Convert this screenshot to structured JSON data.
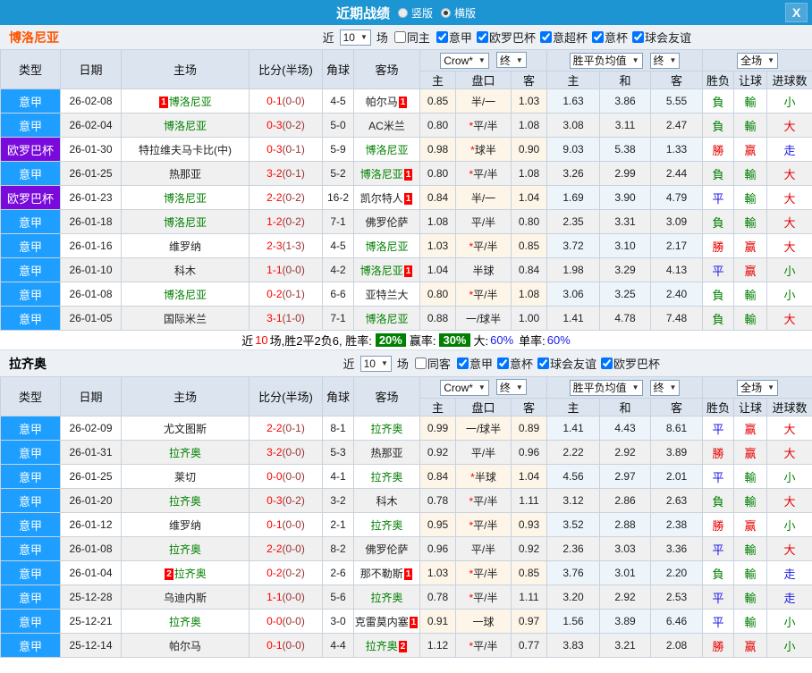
{
  "titlebar": {
    "title": "近期战绩",
    "vertical_label": "竖版",
    "horizontal_label": "横版",
    "layout_selected": "横版",
    "close_glyph": "X"
  },
  "controls": {
    "near_label": "近",
    "count_value": "10",
    "games_label": "场",
    "bookmaker": "Crow*",
    "final_label": "终",
    "wdl_label": "胜平负均值",
    "scope_label": "全场"
  },
  "columns": {
    "type": "类型",
    "date": "日期",
    "home": "主场",
    "score": "比分(半场)",
    "corner": "角球",
    "away": "客场",
    "odds_home": "主",
    "line": "盘口",
    "odds_away": "客",
    "avg_home": "主",
    "avg_draw": "和",
    "avg_away": "客",
    "result": "胜负",
    "handicap": "让球",
    "goals": "进球数"
  },
  "league_colors": {
    "意甲": "#1e9fff",
    "欧罗巴杯": "#7a0adc"
  },
  "result_colors": {
    "red": "#e60000",
    "green": "#008000",
    "blue": "#1a1ae6"
  },
  "accent_colors": {
    "titlebar": "#1d95d3",
    "team1": "#ff5400",
    "badge": "#ff0000",
    "pct_badge": "#008000"
  },
  "sections": [
    {
      "team": "博洛尼亚",
      "team_color": "#ff5400",
      "filter": {
        "same_label": "同主",
        "same_checked": false,
        "leagues": [
          "意甲",
          "欧罗巴杯",
          "意超杯",
          "意杯",
          "球会友谊"
        ]
      },
      "rows": [
        {
          "league": "意甲",
          "date": "26-02-08",
          "home": {
            "badge_before": "1",
            "name": "博洛尼亚",
            "is_team": true
          },
          "score": "0-1",
          "half": "(0-0)",
          "corners": "4-5",
          "away": {
            "name": "帕尔马",
            "badge_after": "1"
          },
          "odds": [
            "0.85",
            "半/一",
            "1.03"
          ],
          "avg": [
            "1.63",
            "3.86",
            "5.55"
          ],
          "result": [
            "負",
            "green"
          ],
          "handicap": [
            "輸",
            "green"
          ],
          "goals": [
            "小",
            "green"
          ]
        },
        {
          "league": "意甲",
          "date": "26-02-04",
          "home": {
            "name": "博洛尼亚",
            "is_team": true
          },
          "score": "0-3",
          "half": "(0-2)",
          "corners": "5-0",
          "away": {
            "name": "AC米兰"
          },
          "odds": [
            "0.80",
            "*平/半",
            "1.08"
          ],
          "avg": [
            "3.08",
            "3.11",
            "2.47"
          ],
          "result": [
            "負",
            "green"
          ],
          "handicap": [
            "輸",
            "green"
          ],
          "goals": [
            "大",
            "red"
          ]
        },
        {
          "league": "欧罗巴杯",
          "date": "26-01-30",
          "home": {
            "name": "特拉维夫马卡比(中)"
          },
          "score": "0-3",
          "half": "(0-1)",
          "corners": "5-9",
          "away": {
            "name": "博洛尼亚",
            "is_team": true
          },
          "odds": [
            "0.98",
            "*球半",
            "0.90"
          ],
          "avg": [
            "9.03",
            "5.38",
            "1.33"
          ],
          "result": [
            "勝",
            "red"
          ],
          "handicap": [
            "赢",
            "red"
          ],
          "goals": [
            "走",
            "blue"
          ]
        },
        {
          "league": "意甲",
          "date": "26-01-25",
          "home": {
            "name": "热那亚"
          },
          "score": "3-2",
          "half": "(0-1)",
          "corners": "5-2",
          "away": {
            "name": "博洛尼亚",
            "is_team": true,
            "badge_after": "1"
          },
          "odds": [
            "0.80",
            "*平/半",
            "1.08"
          ],
          "avg": [
            "3.26",
            "2.99",
            "2.44"
          ],
          "result": [
            "負",
            "green"
          ],
          "handicap": [
            "輸",
            "green"
          ],
          "goals": [
            "大",
            "red"
          ]
        },
        {
          "league": "欧罗巴杯",
          "date": "26-01-23",
          "home": {
            "name": "博洛尼亚",
            "is_team": true
          },
          "score": "2-2",
          "half": "(0-2)",
          "corners": "16-2",
          "away": {
            "name": "凯尔特人",
            "badge_after": "1"
          },
          "odds": [
            "0.84",
            "半/一",
            "1.04"
          ],
          "avg": [
            "1.69",
            "3.90",
            "4.79"
          ],
          "result": [
            "平",
            "blue"
          ],
          "handicap": [
            "輸",
            "green"
          ],
          "goals": [
            "大",
            "red"
          ]
        },
        {
          "league": "意甲",
          "date": "26-01-18",
          "home": {
            "name": "博洛尼亚",
            "is_team": true
          },
          "score": "1-2",
          "half": "(0-2)",
          "corners": "7-1",
          "away": {
            "name": "佛罗伦萨"
          },
          "odds": [
            "1.08",
            "平/半",
            "0.80"
          ],
          "avg": [
            "2.35",
            "3.31",
            "3.09"
          ],
          "result": [
            "負",
            "green"
          ],
          "handicap": [
            "輸",
            "green"
          ],
          "goals": [
            "大",
            "red"
          ]
        },
        {
          "league": "意甲",
          "date": "26-01-16",
          "home": {
            "name": "维罗纳"
          },
          "score": "2-3",
          "half": "(1-3)",
          "corners": "4-5",
          "away": {
            "name": "博洛尼亚",
            "is_team": true
          },
          "odds": [
            "1.03",
            "*平/半",
            "0.85"
          ],
          "avg": [
            "3.72",
            "3.10",
            "2.17"
          ],
          "result": [
            "勝",
            "red"
          ],
          "handicap": [
            "赢",
            "red"
          ],
          "goals": [
            "大",
            "red"
          ]
        },
        {
          "league": "意甲",
          "date": "26-01-10",
          "home": {
            "name": "科木"
          },
          "score": "1-1",
          "half": "(0-0)",
          "corners": "4-2",
          "away": {
            "name": "博洛尼亚",
            "is_team": true,
            "badge_after": "1"
          },
          "odds": [
            "1.04",
            "半球",
            "0.84"
          ],
          "avg": [
            "1.98",
            "3.29",
            "4.13"
          ],
          "result": [
            "平",
            "blue"
          ],
          "handicap": [
            "赢",
            "red"
          ],
          "goals": [
            "小",
            "green"
          ]
        },
        {
          "league": "意甲",
          "date": "26-01-08",
          "home": {
            "name": "博洛尼亚",
            "is_team": true
          },
          "score": "0-2",
          "half": "(0-1)",
          "corners": "6-6",
          "away": {
            "name": "亚特兰大"
          },
          "odds": [
            "0.80",
            "*平/半",
            "1.08"
          ],
          "avg": [
            "3.06",
            "3.25",
            "2.40"
          ],
          "result": [
            "負",
            "green"
          ],
          "handicap": [
            "輸",
            "green"
          ],
          "goals": [
            "小",
            "green"
          ]
        },
        {
          "league": "意甲",
          "date": "26-01-05",
          "home": {
            "name": "国际米兰"
          },
          "score": "3-1",
          "half": "(1-0)",
          "corners": "7-1",
          "away": {
            "name": "博洛尼亚",
            "is_team": true
          },
          "odds": [
            "0.88",
            "一/球半",
            "1.00"
          ],
          "avg": [
            "1.41",
            "4.78",
            "7.48"
          ],
          "result": [
            "負",
            "green"
          ],
          "handicap": [
            "輸",
            "green"
          ],
          "goals": [
            "大",
            "red"
          ]
        }
      ],
      "summary": {
        "near": "近",
        "count": "10",
        "detail": "场,胜2平2负6, 胜率:",
        "win_pct": "20%",
        "ying_label": "赢率:",
        "ying_pct": "30%",
        "big_label": "大:",
        "big_pct": "60%",
        "single_label": "单率:",
        "single_pct": "60%"
      }
    },
    {
      "team": "拉齐奥",
      "team_color": "#000000",
      "filter": {
        "same_label": "同客",
        "same_checked": false,
        "leagues": [
          "意甲",
          "意杯",
          "球会友谊",
          "欧罗巴杯"
        ]
      },
      "rows": [
        {
          "league": "意甲",
          "date": "26-02-09",
          "home": {
            "name": "尤文图斯"
          },
          "score": "2-2",
          "half": "(0-1)",
          "corners": "8-1",
          "away": {
            "name": "拉齐奥",
            "is_team": true
          },
          "odds": [
            "0.99",
            "一/球半",
            "0.89"
          ],
          "avg": [
            "1.41",
            "4.43",
            "8.61"
          ],
          "result": [
            "平",
            "blue"
          ],
          "handicap": [
            "赢",
            "red"
          ],
          "goals": [
            "大",
            "red"
          ]
        },
        {
          "league": "意甲",
          "date": "26-01-31",
          "home": {
            "name": "拉齐奥",
            "is_team": true
          },
          "score": "3-2",
          "half": "(0-0)",
          "corners": "5-3",
          "away": {
            "name": "热那亚"
          },
          "odds": [
            "0.92",
            "平/半",
            "0.96"
          ],
          "avg": [
            "2.22",
            "2.92",
            "3.89"
          ],
          "result": [
            "勝",
            "red"
          ],
          "handicap": [
            "赢",
            "red"
          ],
          "goals": [
            "大",
            "red"
          ]
        },
        {
          "league": "意甲",
          "date": "26-01-25",
          "home": {
            "name": "莱切"
          },
          "score": "0-0",
          "half": "(0-0)",
          "corners": "4-1",
          "away": {
            "name": "拉齐奥",
            "is_team": true
          },
          "odds": [
            "0.84",
            "*半球",
            "1.04"
          ],
          "avg": [
            "4.56",
            "2.97",
            "2.01"
          ],
          "result": [
            "平",
            "blue"
          ],
          "handicap": [
            "輸",
            "green"
          ],
          "goals": [
            "小",
            "green"
          ]
        },
        {
          "league": "意甲",
          "date": "26-01-20",
          "home": {
            "name": "拉齐奥",
            "is_team": true
          },
          "score": "0-3",
          "half": "(0-2)",
          "corners": "3-2",
          "away": {
            "name": "科木"
          },
          "odds": [
            "0.78",
            "*平/半",
            "1.11"
          ],
          "avg": [
            "3.12",
            "2.86",
            "2.63"
          ],
          "result": [
            "負",
            "green"
          ],
          "handicap": [
            "輸",
            "green"
          ],
          "goals": [
            "大",
            "red"
          ]
        },
        {
          "league": "意甲",
          "date": "26-01-12",
          "home": {
            "name": "维罗纳"
          },
          "score": "0-1",
          "half": "(0-0)",
          "corners": "2-1",
          "away": {
            "name": "拉齐奥",
            "is_team": true
          },
          "odds": [
            "0.95",
            "*平/半",
            "0.93"
          ],
          "avg": [
            "3.52",
            "2.88",
            "2.38"
          ],
          "result": [
            "勝",
            "red"
          ],
          "handicap": [
            "赢",
            "red"
          ],
          "goals": [
            "小",
            "green"
          ]
        },
        {
          "league": "意甲",
          "date": "26-01-08",
          "home": {
            "name": "拉齐奥",
            "is_team": true
          },
          "score": "2-2",
          "half": "(0-0)",
          "corners": "8-2",
          "away": {
            "name": "佛罗伦萨"
          },
          "odds": [
            "0.96",
            "平/半",
            "0.92"
          ],
          "avg": [
            "2.36",
            "3.03",
            "3.36"
          ],
          "result": [
            "平",
            "blue"
          ],
          "handicap": [
            "輸",
            "green"
          ],
          "goals": [
            "大",
            "red"
          ]
        },
        {
          "league": "意甲",
          "date": "26-01-04",
          "home": {
            "badge_before": "2",
            "name": "拉齐奥",
            "is_team": true
          },
          "score": "0-2",
          "half": "(0-2)",
          "corners": "2-6",
          "away": {
            "name": "那不勒斯",
            "badge_after": "1"
          },
          "odds": [
            "1.03",
            "*平/半",
            "0.85"
          ],
          "avg": [
            "3.76",
            "3.01",
            "2.20"
          ],
          "result": [
            "負",
            "green"
          ],
          "handicap": [
            "輸",
            "green"
          ],
          "goals": [
            "走",
            "blue"
          ]
        },
        {
          "league": "意甲",
          "date": "25-12-28",
          "home": {
            "name": "乌迪内斯"
          },
          "score": "1-1",
          "half": "(0-0)",
          "corners": "5-6",
          "away": {
            "name": "拉齐奥",
            "is_team": true
          },
          "odds": [
            "0.78",
            "*平/半",
            "1.11"
          ],
          "avg": [
            "3.20",
            "2.92",
            "2.53"
          ],
          "result": [
            "平",
            "blue"
          ],
          "handicap": [
            "輸",
            "green"
          ],
          "goals": [
            "走",
            "blue"
          ]
        },
        {
          "league": "意甲",
          "date": "25-12-21",
          "home": {
            "name": "拉齐奥",
            "is_team": true
          },
          "score": "0-0",
          "half": "(0-0)",
          "corners": "3-0",
          "away": {
            "name": "克雷莫内塞",
            "badge_after": "1"
          },
          "odds": [
            "0.91",
            "一球",
            "0.97"
          ],
          "avg": [
            "1.56",
            "3.89",
            "6.46"
          ],
          "result": [
            "平",
            "blue"
          ],
          "handicap": [
            "輸",
            "green"
          ],
          "goals": [
            "小",
            "green"
          ]
        },
        {
          "league": "意甲",
          "date": "25-12-14",
          "home": {
            "name": "帕尔马"
          },
          "score": "0-1",
          "half": "(0-0)",
          "corners": "4-4",
          "away": {
            "name": "拉齐奥",
            "is_team": true,
            "badge_after": "2"
          },
          "odds": [
            "1.12",
            "*平/半",
            "0.77"
          ],
          "avg": [
            "3.83",
            "3.21",
            "2.08"
          ],
          "result": [
            "勝",
            "red"
          ],
          "handicap": [
            "赢",
            "red"
          ],
          "goals": [
            "小",
            "green"
          ]
        }
      ]
    }
  ]
}
